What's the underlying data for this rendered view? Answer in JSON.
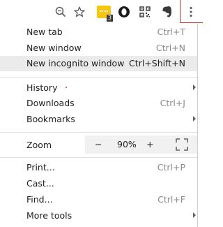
{
  "toolbar": {
    "extension_badge": "3",
    "icons": [
      "zoom-icon",
      "star-icon",
      "extension-icon",
      "opera-icon",
      "qr-code-icon",
      "evernote-icon",
      "more-menu-icon"
    ]
  },
  "menu": {
    "new_tab": {
      "label": "New tab",
      "shortcut": "Ctrl+T"
    },
    "new_window": {
      "label": "New window",
      "shortcut": "Ctrl+N"
    },
    "new_incognito": {
      "label": "New incognito window",
      "shortcut": "Ctrl+Shift+N"
    },
    "history": {
      "label": "History"
    },
    "downloads": {
      "label": "Downloads",
      "shortcut": "Ctrl+J"
    },
    "bookmarks": {
      "label": "Bookmarks"
    },
    "zoom": {
      "label": "Zoom",
      "minus": "−",
      "value": "90%",
      "plus": "+"
    },
    "print": {
      "label": "Print...",
      "shortcut": "Ctrl+P"
    },
    "cast": {
      "label": "Cast..."
    },
    "find": {
      "label": "Find...",
      "shortcut": "Ctrl+F"
    },
    "more_tools": {
      "label": "More tools"
    }
  },
  "colors": {
    "highlight": "#ebebeb",
    "badge": "#f9c513",
    "accent_red": "#d93025"
  }
}
